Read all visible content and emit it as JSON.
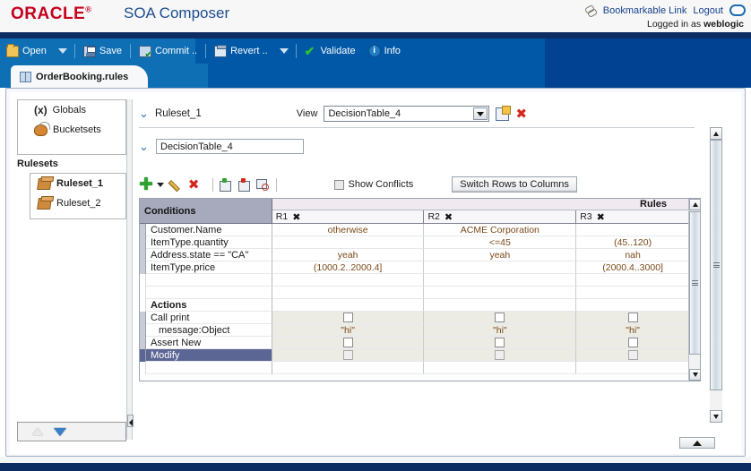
{
  "brand": {
    "logo": "ORACLE",
    "trademark": "®",
    "app_title": "SOA Composer",
    "bookmark_link": "Bookmarkable Link",
    "logout": "Logout",
    "logged_in_prefix": "Logged in as",
    "logged_in_user": "weblogic",
    "accent_red": "#c6001f",
    "accent_blue": "#1d4e8f"
  },
  "toolbar": {
    "open": "Open",
    "save": "Save",
    "commit": "Commit ..",
    "revert": "Revert ..",
    "validate": "Validate",
    "info": "Info"
  },
  "tabs": [
    {
      "label": "OrderBooking.rules",
      "active": true
    }
  ],
  "sidebar": {
    "globals": "Globals",
    "globals_glyph": "(x)",
    "bucketsets": "Bucketsets",
    "rulesets_header": "Rulesets",
    "rulesets": [
      {
        "label": "Ruleset_1",
        "selected": true
      },
      {
        "label": "Ruleset_2",
        "selected": false
      }
    ]
  },
  "editor": {
    "ruleset_name": "Ruleset_1",
    "view_label": "View",
    "view_value": "DecisionTable_4",
    "table_name": "DecisionTable_4",
    "show_conflicts_label": "Show Conflicts",
    "show_conflicts_checked": false,
    "switch_button": "Switch Rows to Columns"
  },
  "decision_table": {
    "conditions_header": "Conditions",
    "rules_header": "Rules",
    "actions_header": "Actions",
    "rule_columns": [
      {
        "id": "R1"
      },
      {
        "id": "R2"
      },
      {
        "id": "R3"
      }
    ],
    "conditions": [
      {
        "label": "Customer.Name",
        "cells": [
          "otherwise",
          "ACME Corporation",
          ""
        ]
      },
      {
        "label": "ItemType.quantity",
        "cells": [
          "",
          "<=45",
          "(45..120)"
        ]
      },
      {
        "label": "Address.state == \"CA\"",
        "cells": [
          "yeah",
          "yeah",
          "nah"
        ]
      },
      {
        "label": "ItemType.price",
        "cells": [
          "(1000.2..2000.4]",
          "",
          "(2000.4..3000]"
        ]
      }
    ],
    "actions": [
      {
        "label": "Call print",
        "type": "checkbox",
        "indent": false,
        "selected": false,
        "cells": [
          false,
          false,
          false
        ]
      },
      {
        "label": "message:Object",
        "type": "text",
        "indent": true,
        "selected": false,
        "cells": [
          "\"hi\"",
          "\"hi\"",
          "\"hi\""
        ]
      },
      {
        "label": "Assert New",
        "type": "checkbox",
        "indent": false,
        "selected": false,
        "cells": [
          false,
          false,
          false
        ]
      },
      {
        "label": "Modify",
        "type": "checkbox-disabled",
        "indent": false,
        "selected": true,
        "cells": [
          false,
          false,
          false
        ]
      }
    ]
  },
  "icons": {
    "bookmark": "link-icon",
    "user_session": "session-oval-icon",
    "open": "folder-icon",
    "save": "floppy-icon",
    "commit": "commit-check-icon",
    "revert": "revert-icon",
    "validate": "green-check-icon",
    "info": "info-circle-icon",
    "tab": "book-icon",
    "globals": "globals-x-icon",
    "bucketsets": "bucketsets-icon",
    "ruleset": "ruleset-cube-icon",
    "new_table": "new-decision-table-icon",
    "delete_table": "delete-red-x-icon",
    "add": "green-plus-icon",
    "edit": "pencil-icon",
    "delete": "red-x-icon",
    "insert_col_before": "insert-column-icon",
    "insert_col_after": "insert-column-after-icon",
    "find_col": "find-column-icon"
  }
}
